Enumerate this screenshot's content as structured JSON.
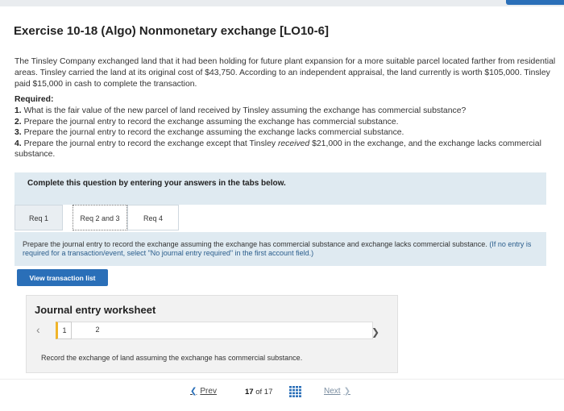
{
  "header": {
    "title": "Exercise 10-18 (Algo) Nonmonetary exchange [LO10-6]"
  },
  "intro": {
    "text": "The Tinsley Company exchanged land that it had been holding for future plant expansion for a more suitable parcel located farther from residential areas. Tinsley carried the land at its original cost of $43,750. According to an independent appraisal, the land currently is worth $105,000. Tinsley paid $15,000 in cash to complete the transaction."
  },
  "required": {
    "label": "Required:",
    "items": [
      {
        "num": "1.",
        "text": "What is the fair value of the new parcel of land received by Tinsley assuming the exchange has commercial substance?"
      },
      {
        "num": "2.",
        "text": "Prepare the journal entry to record the exchange assuming the exchange has commercial substance."
      },
      {
        "num": "3.",
        "text": "Prepare the journal entry to record the exchange assuming the exchange lacks commercial substance."
      },
      {
        "num": "4.",
        "text_before": "Prepare the journal entry to record the exchange except that Tinsley ",
        "text_em": "received",
        "text_after": " $21,000 in the exchange, and the exchange lacks commercial substance."
      }
    ]
  },
  "complete_box": {
    "text": "Complete this question by entering your answers in the tabs below."
  },
  "tabs": [
    {
      "label": "Req 1"
    },
    {
      "label": "Req 2 and 3"
    },
    {
      "label": "Req 4"
    }
  ],
  "instruction": {
    "text": "Prepare the journal entry to record the exchange assuming the exchange has commercial substance and exchange lacks commercial substance.",
    "note": "(If no entry is required for a transaction/event, select \"No journal entry required\" in the first account field.)"
  },
  "view_button": {
    "label": "View transaction list"
  },
  "worksheet": {
    "title": "Journal entry worksheet",
    "pages": [
      "1",
      "2"
    ],
    "description": "Record the exchange of land assuming the exchange has commercial substance."
  },
  "footer": {
    "prev_label": "Prev",
    "current": "17",
    "of_label": "of",
    "total": "17",
    "next_label": "Next"
  },
  "colors": {
    "accent": "#2a6fb8",
    "panel": "#dfeaf1"
  }
}
